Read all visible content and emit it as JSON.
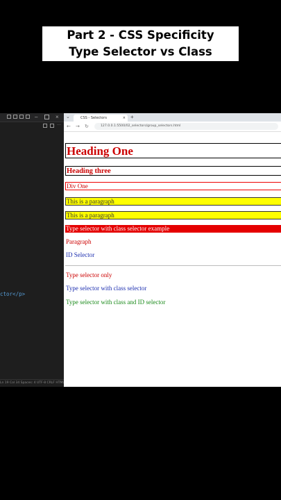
{
  "title": {
    "line1": "Part 2 - CSS Specificity",
    "line2": "Type Selector vs Class Selector"
  },
  "editor": {
    "code_line": "ctor</p>",
    "status": "Ln 19 Col 34   Spaces: 4   UTF-8   CRLF   HTML"
  },
  "browser": {
    "tab_title": "CSS - Selectors",
    "new_tab": "+",
    "url": "127.0.0.1:5500/02_selectors/group_selectors.html",
    "nav": {
      "back": "←",
      "forward": "→",
      "reload": "↻"
    }
  },
  "page": {
    "heading_one": "Heading One",
    "heading_three": "Heading three",
    "div_one": "Div One",
    "paragraph_1": "This is a paragraph",
    "paragraph_2": "This is a paragraph",
    "type_class_example": "Type selector with class selector example",
    "paragraph": "Paragraph",
    "id_selector": "ID Selector",
    "type_only": "Type selector only",
    "type_with_class": "Type selector with class selector",
    "type_with_class_id": "Type selector with class and ID selector"
  },
  "colors": {
    "red": "#cc0000",
    "blue": "#1d2fb0",
    "green": "#1a8a1a",
    "yellow": "#ffff00",
    "red_bar": "#e50000"
  }
}
